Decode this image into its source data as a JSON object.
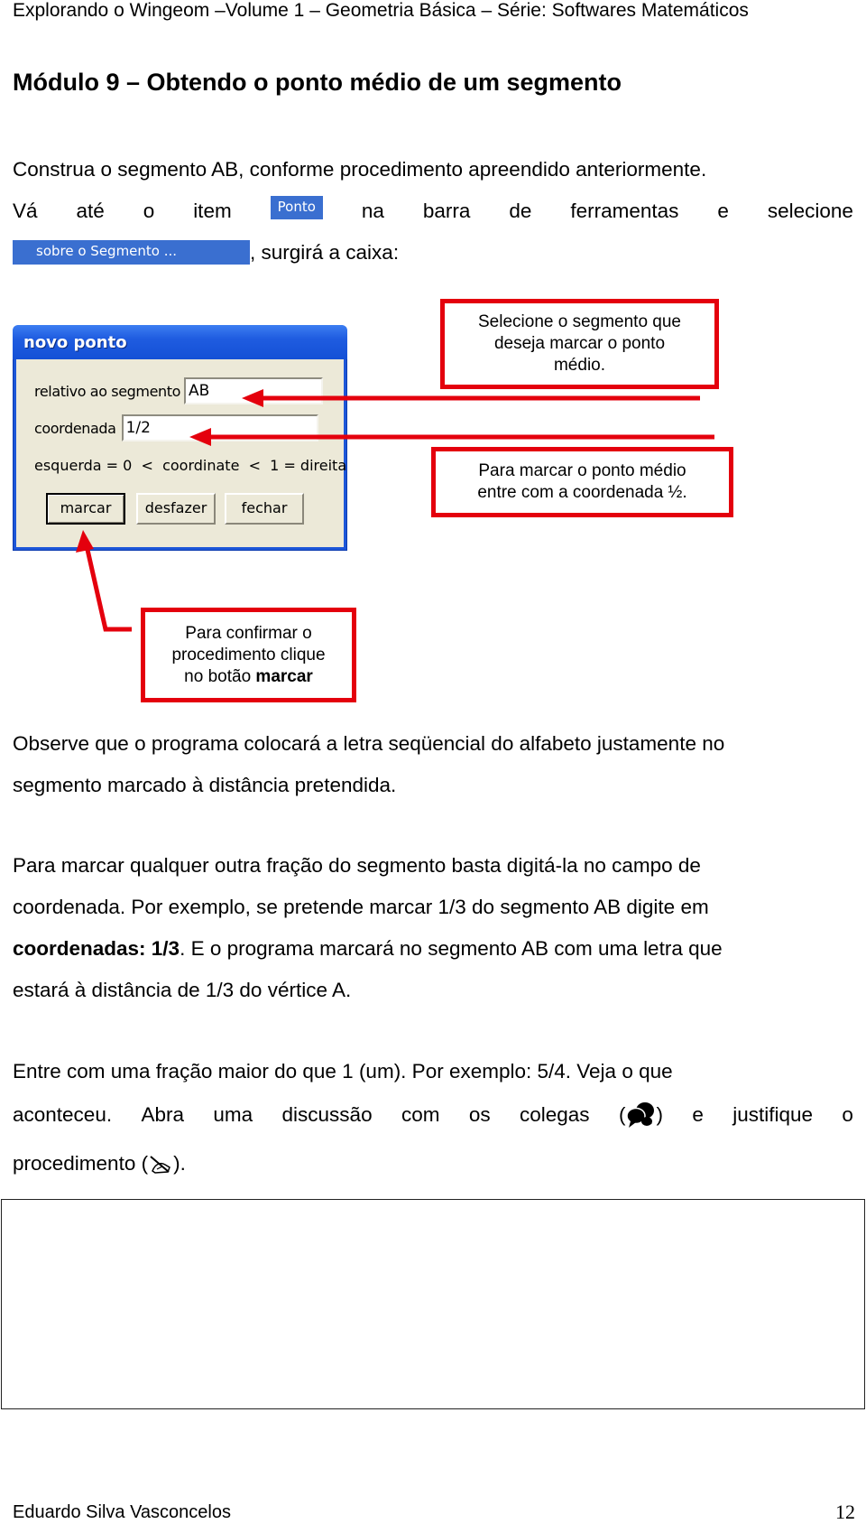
{
  "header": {
    "running_title": "Explorando o Wingeom –Volume 1 – Geometria Básica – Série: Softwares Matemáticos"
  },
  "module": {
    "title": "Módulo 9 – Obtendo o ponto médio de um segmento"
  },
  "intro": {
    "line1": "Construa o segmento AB, conforme procedimento apreendido anteriormente.",
    "line2_words_before": [
      "Vá",
      "até",
      "o",
      "item"
    ],
    "menu_item": "Ponto",
    "line2_words_after": [
      "na",
      "barra",
      "de",
      "ferramentas",
      "e",
      "selecione"
    ],
    "submenu_item": "sobre o Segmento ...",
    "line3_suffix": ", surgirá a caixa:"
  },
  "dialog": {
    "title": "novo ponto",
    "segment_label": "relativo ao segmento",
    "segment_value": "AB",
    "coordinate_label": "coordenada",
    "coordinate_value": "1/2",
    "hint": "esquerda = 0  <  coordinate  <  1 = direita",
    "buttons": {
      "mark": "marcar",
      "undo": "desfazer",
      "close": "fechar"
    },
    "colors": {
      "titlebar": "#1f5ce0",
      "body": "#ece9d8"
    }
  },
  "callouts": {
    "select_segment": [
      "Selecione o segmento que",
      "deseja marcar o ponto",
      "médio."
    ],
    "enter_coordinate": [
      "Para marcar o ponto médio",
      "entre com a coordenada ½."
    ],
    "confirm": {
      "line1": "Para confirmar o",
      "line2": "procedimento clique",
      "line3_prefix": "no botão ",
      "line3_bold": "marcar"
    },
    "color": "#e4000d"
  },
  "paragraphs": {
    "observe": {
      "line1": "Observe que o programa colocará a letra seqüencial do alfabeto justamente no",
      "line2": "segmento marcado à distância pretendida."
    },
    "fraction": {
      "line1": "Para marcar qualquer outra fração do segmento basta digitá-la no campo de",
      "line2": "coordenada. Por exemplo, se pretende marcar 1/3 do segmento AB digite em",
      "line3_bold": "coordenadas: 1/3",
      "line3_rest": ". E o programa marcará no segmento AB com uma letra que",
      "line4": "estará à distância de 1/3 do vértice A."
    },
    "challenge": {
      "line1": "Entre com uma fração maior do que 1 (um). Por exemplo: 5/4. Veja o que",
      "line2_before": [
        "aconteceu.",
        "Abra",
        "uma",
        "discussão",
        "com",
        "os",
        "colegas",
        "("
      ],
      "line2_after": [
        ")",
        "e",
        "justifique",
        "o"
      ],
      "line3_before": "procedimento (",
      "line3_after": ")."
    }
  },
  "icons": {
    "discussion": "speech-bubbles-icon",
    "writing": "writing-hand-icon"
  },
  "footer": {
    "author": "Eduardo Silva Vasconcelos",
    "page_number": "12"
  }
}
